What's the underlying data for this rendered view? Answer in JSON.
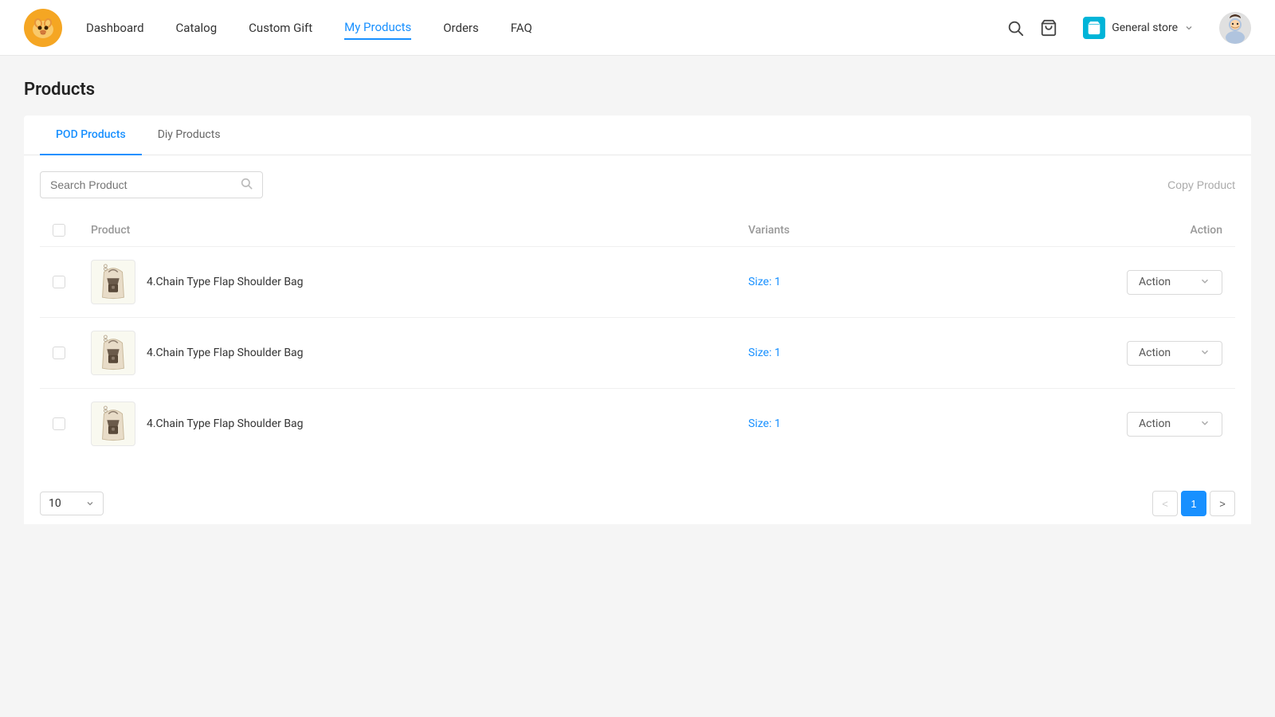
{
  "header": {
    "logo_alt": "ShineOn logo",
    "nav_items": [
      {
        "label": "Dashboard",
        "active": false
      },
      {
        "label": "Catalog",
        "active": false
      },
      {
        "label": "Custom Gift",
        "active": false
      },
      {
        "label": "My Products",
        "active": true
      },
      {
        "label": "Orders",
        "active": false
      },
      {
        "label": "FAQ",
        "active": false
      }
    ],
    "store_name": "General store",
    "store_icon": "🛍",
    "search_icon": "🔍",
    "cart_icon": "🛒"
  },
  "page": {
    "title": "Products"
  },
  "tabs": [
    {
      "label": "POD Products",
      "active": true
    },
    {
      "label": "Diy Products",
      "active": false
    }
  ],
  "toolbar": {
    "search_placeholder": "Search Product",
    "copy_product_label": "Copy Product"
  },
  "table": {
    "columns": [
      {
        "label": "",
        "type": "checkbox"
      },
      {
        "label": "Product"
      },
      {
        "label": "Variants"
      },
      {
        "label": "Action",
        "align": "right"
      }
    ],
    "rows": [
      {
        "id": 1,
        "product_name": "4.Chain Type Flap Shoulder Bag",
        "variants_label": "Size:",
        "variants_value": "1",
        "action_label": "Action"
      },
      {
        "id": 2,
        "product_name": "4.Chain Type Flap Shoulder Bag",
        "variants_label": "Size:",
        "variants_value": "1",
        "action_label": "Action"
      },
      {
        "id": 3,
        "product_name": "4.Chain Type Flap Shoulder Bag",
        "variants_label": "Size:",
        "variants_value": "1",
        "action_label": "Action"
      }
    ]
  },
  "pagination": {
    "page_size": "10",
    "current_page": 1,
    "prev_label": "<",
    "next_label": ">"
  }
}
